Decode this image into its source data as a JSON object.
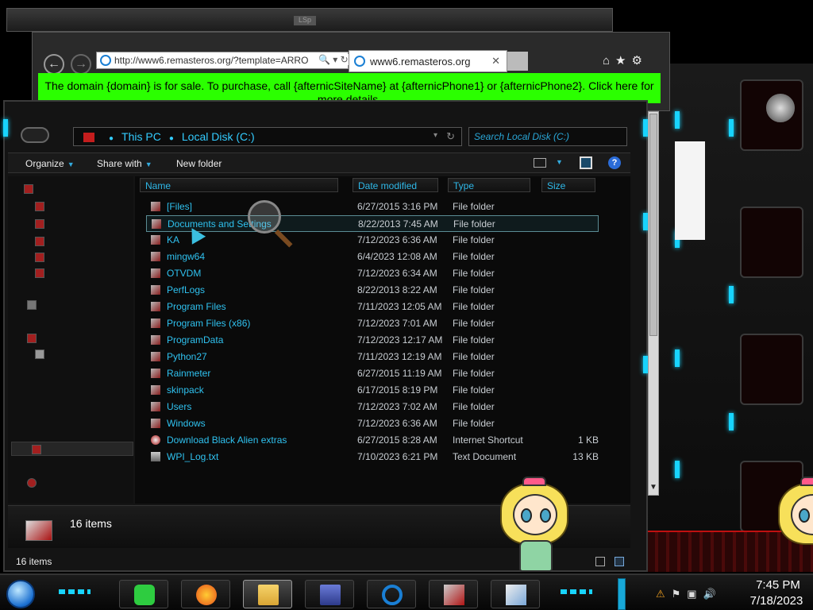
{
  "background_window": {
    "title": "LSp"
  },
  "browser": {
    "back_glyph": "←",
    "forward_glyph": "→",
    "address": "http://www6.remasteros.org/?template=ARRO",
    "address_controls": "🔍 ▾ ↻",
    "tab_title": "www6.remasteros.org",
    "tab_close": "✕",
    "toolbar_icons": "⌂★⚙",
    "banner_text": "The domain {domain} is for sale. To purchase, call {afternicSiteName} at {afternicPhone1} or {afternicPhone2}. Click here for more details."
  },
  "explorer": {
    "breadcrumb": [
      "This PC",
      "Local Disk (C:)"
    ],
    "breadcrumb_chevron": "▾",
    "refresh_glyph": "↻",
    "search_placeholder": "Search Local Disk (C:)",
    "toolbar": {
      "organize": "Organize",
      "share_with": "Share with",
      "new_folder": "New folder",
      "help": "?",
      "caret": "▼"
    },
    "columns": {
      "name": "Name",
      "date_modified": "Date modified",
      "type": "Type",
      "size": "Size"
    },
    "files": [
      {
        "name": "[Files]",
        "date": "6/27/2015 3:16 PM",
        "type": "File folder",
        "size": "",
        "icon": "folder-icon"
      },
      {
        "name": "Documents and Settings",
        "date": "8/22/2013 7:45 AM",
        "type": "File folder",
        "size": "",
        "icon": "folder-icon"
      },
      {
        "name": "KA",
        "date": "7/12/2023 6:36 AM",
        "type": "File folder",
        "size": "",
        "icon": "folder-icon"
      },
      {
        "name": "mingw64",
        "date": "6/4/2023 12:08 AM",
        "type": "File folder",
        "size": "",
        "icon": "folder-icon"
      },
      {
        "name": "OTVDM",
        "date": "7/12/2023 6:34 AM",
        "type": "File folder",
        "size": "",
        "icon": "folder-icon"
      },
      {
        "name": "PerfLogs",
        "date": "8/22/2013 8:22 AM",
        "type": "File folder",
        "size": "",
        "icon": "folder-icon"
      },
      {
        "name": "Program Files",
        "date": "7/11/2023 12:05 AM",
        "type": "File folder",
        "size": "",
        "icon": "folder-icon"
      },
      {
        "name": "Program Files (x86)",
        "date": "7/12/2023 7:01 AM",
        "type": "File folder",
        "size": "",
        "icon": "folder-icon"
      },
      {
        "name": "ProgramData",
        "date": "7/12/2023 12:17 AM",
        "type": "File folder",
        "size": "",
        "icon": "folder-icon"
      },
      {
        "name": "Python27",
        "date": "7/11/2023 12:19 AM",
        "type": "File folder",
        "size": "",
        "icon": "folder-icon"
      },
      {
        "name": "Rainmeter",
        "date": "6/27/2015 11:19 AM",
        "type": "File folder",
        "size": "",
        "icon": "folder-icon"
      },
      {
        "name": "skinpack",
        "date": "6/17/2015 8:19 PM",
        "type": "File folder",
        "size": "",
        "icon": "folder-icon"
      },
      {
        "name": "Users",
        "date": "7/12/2023 7:02 AM",
        "type": "File folder",
        "size": "",
        "icon": "folder-icon"
      },
      {
        "name": "Windows",
        "date": "7/12/2023 6:36 AM",
        "type": "File folder",
        "size": "",
        "icon": "folder-icon"
      },
      {
        "name": "Download Black Alien extras",
        "date": "6/27/2015 8:28 AM",
        "type": "Internet Shortcut",
        "size": "1 KB",
        "icon": "internet-shortcut-icon"
      },
      {
        "name": "WPI_Log.txt",
        "date": "7/10/2023 6:21 PM",
        "type": "Text Document",
        "size": "13 KB",
        "icon": "text-document-icon"
      }
    ],
    "selected_index": 1,
    "details_count": "16 items",
    "status_count": "16 items"
  },
  "taskbar": {
    "time": "7:45 PM",
    "date": "7/18/2023",
    "tray_icons": "⚑▣🔊"
  },
  "colors": {
    "accent_cyan": "#2fc2f0",
    "banner_green": "#2bff00",
    "alien_red": "#e01010"
  }
}
